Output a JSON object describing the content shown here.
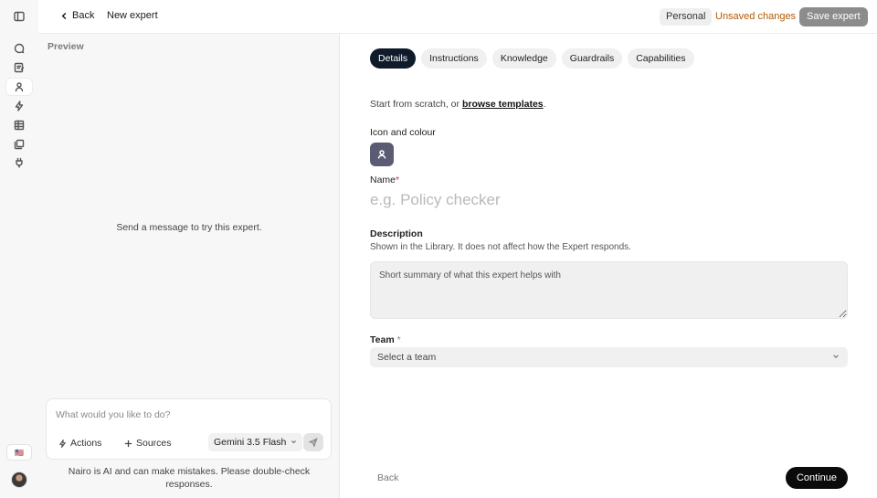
{
  "rail": {
    "items": [
      {
        "icon": "sidebar-toggle-icon"
      },
      {
        "icon": "chat-icon"
      },
      {
        "icon": "notebook-icon"
      },
      {
        "icon": "experts-icon",
        "active": true
      },
      {
        "icon": "lightning-icon"
      },
      {
        "icon": "table-icon"
      },
      {
        "icon": "library-icon"
      },
      {
        "icon": "plug-icon"
      }
    ],
    "flag": "🇺🇸"
  },
  "header": {
    "back_label": "Back",
    "title": "New expert",
    "scope": "Personal",
    "status": "Unsaved changes",
    "save_label": "Save expert"
  },
  "preview": {
    "label": "Preview",
    "empty_message": "Send a message to try this expert.",
    "composer": {
      "placeholder": "What would you like to do?",
      "actions_label": "Actions",
      "sources_label": "Sources",
      "model": "Gemini 3.5 Flash"
    },
    "disclaimer": "Nairo is AI and can make mistakes. Please double-check responses."
  },
  "form": {
    "tabs": [
      {
        "label": "Details",
        "active": true
      },
      {
        "label": "Instructions"
      },
      {
        "label": "Knowledge"
      },
      {
        "label": "Guardrails"
      },
      {
        "label": "Capabilities"
      }
    ],
    "intro_prefix": "Start from scratch, or ",
    "intro_link": "browse templates",
    "intro_suffix": ".",
    "icon_label": "Icon and colour",
    "icon_color": "#5b5b73",
    "name_label": "Name",
    "required_mark": "*",
    "name_placeholder": "e.g. Policy checker",
    "name_value": "",
    "description_label": "Description",
    "description_help": "Shown in the Library. It does not affect how the Expert responds.",
    "description_placeholder": "Short summary of what this expert helps with",
    "team_label": "Team",
    "team_placeholder": "Select a team",
    "back_label": "Back",
    "continue_label": "Continue"
  },
  "colors": {
    "accent": "#0f1a2a",
    "status": "#b35a00",
    "save_disabled": "#8c8c8c"
  }
}
